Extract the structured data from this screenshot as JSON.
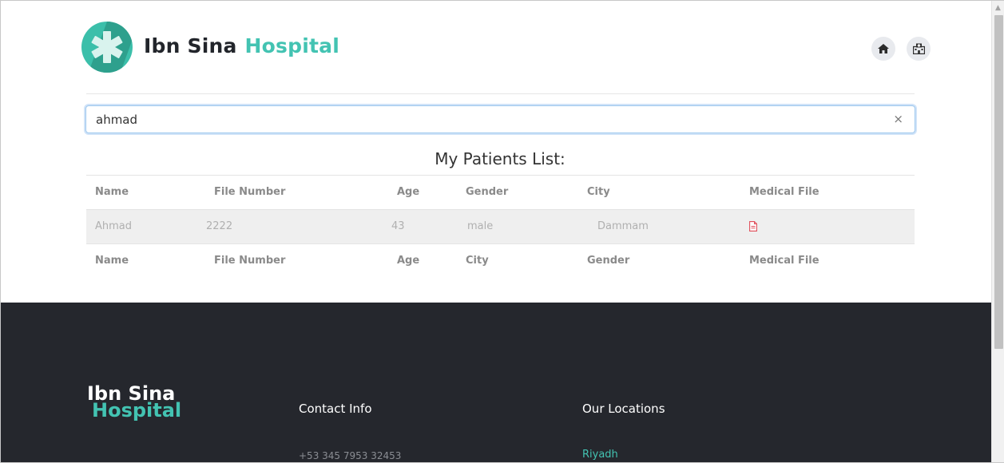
{
  "header": {
    "brand_primary": "Ibn Sina",
    "brand_accent": "Hospital",
    "icons": [
      "home-icon",
      "hospital-icon"
    ],
    "accent_color": "#43c3b2"
  },
  "search": {
    "value": "ahmad",
    "clear_symbol": "×"
  },
  "patients": {
    "title": "My Patients List:",
    "columns": [
      "Name",
      "File Number",
      "Age",
      "Gender",
      "City",
      "Medical File"
    ],
    "rows": [
      {
        "name": "Ahmad",
        "file_number": "2222",
        "age": "43",
        "gender": "male",
        "city": "Dammam",
        "medical_file_icon": "pdf-file-icon"
      }
    ],
    "footer_columns": [
      "Name",
      "File Number",
      "Age",
      "City",
      "Gender",
      "Medical File"
    ]
  },
  "footer": {
    "logo_line1": "Ibn Sina",
    "logo_line2": "Hospital",
    "contact_title": "Contact Info",
    "phone": "+53 345 7953 32453",
    "locations_title": "Our Locations",
    "location_1": "Riyadh",
    "background_color": "#25272d"
  }
}
